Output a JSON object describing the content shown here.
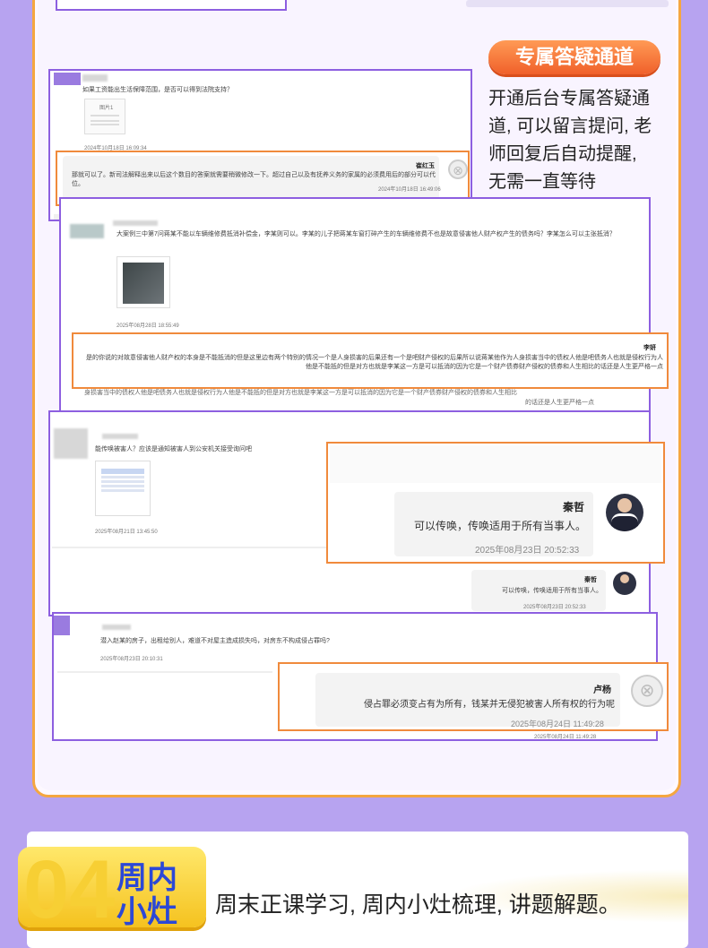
{
  "top_feature": {
    "badge": "专属答疑通道",
    "description_lines": [
      "开通后台专属答疑通",
      "道, 可以留言提问, 老",
      "师回复后自动提醒,",
      "无需一直等待"
    ]
  },
  "chat1": {
    "question": "如果工资能出生活保障范围，是否可以得到法院支持？",
    "question_time": "2024年10月18日 16:09:34",
    "attachment_label": "图片1",
    "teacher": "崔红玉",
    "answer": "那就可以了。新司法解释出来以后这个数目的答案就需要稍微修改一下。超过自己以及有抚养义务的家属的必须费用后的部分可以代位。",
    "answer_time": "2024年10月18日 16:49:06"
  },
  "chat2": {
    "question": "大案例三中第7问蒋某不能以车辆维修费抵消补偿金，李某则可以。李某的儿子把蒋某车窗打碎产生的车辆维修费不也是故意侵害他人财产权产生的债务吗？李某怎么可以主张抵消？",
    "question_time": "2025年08月28日 18:55:49",
    "teacher": "李妍",
    "answer": "是的你说的对故意侵害他人财产权的本身是不能抵消的但是这里边有两个特别的情况一个是人身损害的后果还有一个是吧财产侵权的后果所以说蒋某他作为人身损害当中的债权人他是吧债务人也就是侵权行为人他是不能抵的但是对方也就是李某这一方是可以抵消的因为它是一个财产债券财产侵权的债券和人生相比的话还是人生更严格一点",
    "echo_line1": "身损害当中的债权人他是吧债务人也就是侵权行为人他是不能抵的但是对方也就是李某这一方是可以抵消的因为它是一个财产债券财产侵权的债券和人生相比",
    "echo_line2": "的话还是人生更严格一点"
  },
  "chat3": {
    "question": "能传唤被害人？应该是通知被害人到公安机关接受询问吧",
    "question_time": "2025年08月21日 13:45:50",
    "teacher": "秦哲",
    "answer": "可以传唤，传唤适用于所有当事人。",
    "answer_time": "2025年08月23日 20:52:33"
  },
  "chat4": {
    "question": "潜入赵某的房子，出租给别人，难道不对屋主造成损失吗，对房东不构成侵占罪吗?",
    "question_time": "2025年08月23日 20:10:31",
    "teacher": "卢杨",
    "answer": "侵占罪必须变占有为所有，钱某并无侵犯被害人所有权的行为呢",
    "answer_time": "2025年08月24日 11:49:28"
  },
  "bottom": {
    "number": "04",
    "title_line1": "周内",
    "title_line2": "小灶",
    "description": "周末正课学习, 周内小灶梳理, 讲题解题。"
  },
  "colors": {
    "purple": "#8d5fe0",
    "orange": "#f08a3c",
    "background": "#b7a3f0"
  }
}
